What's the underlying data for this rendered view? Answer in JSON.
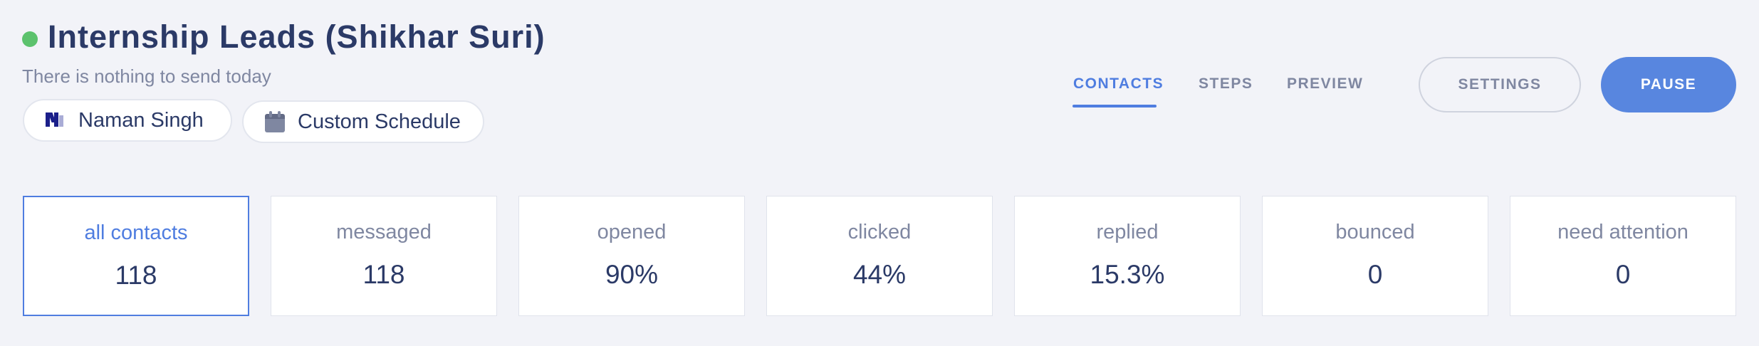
{
  "campaign": {
    "title": "Internship Leads (Shikhar Suri)",
    "status_color": "#5cc26d",
    "subtitle": "There is nothing to send today",
    "owner": {
      "name": "Naman Singh",
      "icon": "brand-logo-icon"
    },
    "schedule": {
      "label": "Custom Schedule",
      "icon": "calendar-icon"
    }
  },
  "tabs": [
    {
      "label": "CONTACTS",
      "active": true
    },
    {
      "label": "STEPS",
      "active": false
    },
    {
      "label": "PREVIEW",
      "active": false
    }
  ],
  "actions": {
    "settings_label": "SETTINGS",
    "pause_label": "PAUSE",
    "accent_color": "#5886df"
  },
  "stats": [
    {
      "label": "all contacts",
      "value": "118",
      "active": true
    },
    {
      "label": "messaged",
      "value": "118",
      "active": false
    },
    {
      "label": "opened",
      "value": "90%",
      "active": false
    },
    {
      "label": "clicked",
      "value": "44%",
      "active": false
    },
    {
      "label": "replied",
      "value": "15.3%",
      "active": false
    },
    {
      "label": "bounced",
      "value": "0",
      "active": false
    },
    {
      "label": "need attention",
      "value": "0",
      "active": false
    }
  ]
}
